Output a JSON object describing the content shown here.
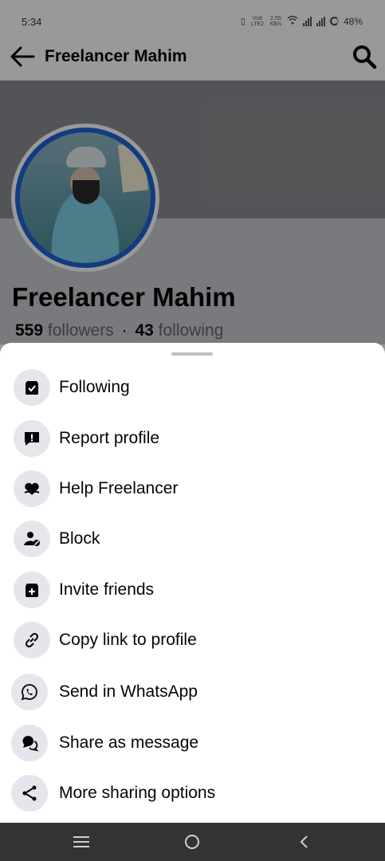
{
  "status_bar": {
    "time": "5:34",
    "volte": "Vo8 LTE2",
    "speed": "2.55 KB/s",
    "battery": "48%"
  },
  "app_bar": {
    "title": "Freelancer Mahim",
    "back_icon": "arrow-left-icon",
    "search_icon": "search-icon"
  },
  "profile": {
    "name": "Freelancer Mahim",
    "followers_count": "559",
    "followers_label": "followers",
    "separator": "·",
    "following_count": "43",
    "following_label": "following"
  },
  "sheet": {
    "items": [
      {
        "label": "Following",
        "icon": "following-check-icon"
      },
      {
        "label": "Report profile",
        "icon": "report-alert-icon"
      },
      {
        "label": "Help Freelancer",
        "icon": "heart-hand-icon"
      },
      {
        "label": "Block",
        "icon": "block-user-icon"
      },
      {
        "label": "Invite friends",
        "icon": "invite-plus-icon"
      },
      {
        "label": "Copy link to profile",
        "icon": "link-icon"
      },
      {
        "label": "Send in WhatsApp",
        "icon": "whatsapp-icon"
      },
      {
        "label": "Share as message",
        "icon": "chat-bubble-icon"
      },
      {
        "label": "More sharing options",
        "icon": "share-icon"
      }
    ]
  },
  "nav_bar": {
    "menu_icon": "recent-apps-icon",
    "home_icon": "home-circle-icon",
    "back_icon": "back-chevron-icon"
  }
}
